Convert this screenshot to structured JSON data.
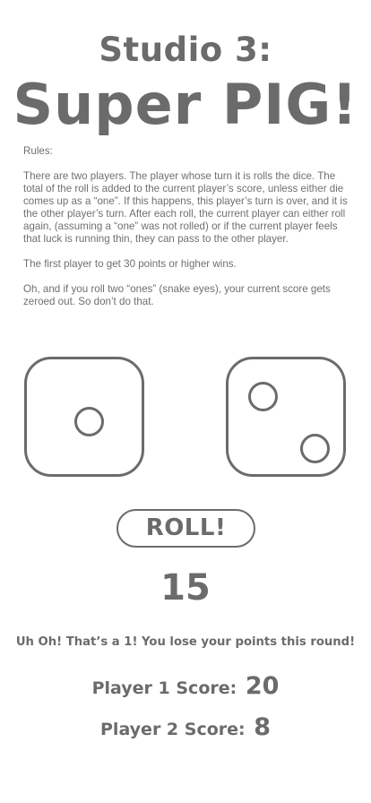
{
  "header": {
    "subtitle": "Studio 3:",
    "title": "Super PIG!"
  },
  "rules": {
    "heading": "Rules:",
    "paragraph_1": "There are two players. The player whose turn it is rolls the dice. The total of the roll is added to the current player’s score, unless either die comes up as a “one”. If this happens, this player’s turn is over, and it is the other player’s turn. After each roll, the current player can either roll again, (assuming a “one” was not rolled) or if the current player feels that luck is running thin, they can pass to the other player.",
    "paragraph_2": "The first player to get 30 points or higher wins.",
    "paragraph_3": "Oh, and if you roll two “ones” (snake eyes), your current score gets zeroed out. So don’t do that."
  },
  "dice": {
    "left_value": 1,
    "right_value": 2
  },
  "roll_button": {
    "label": "ROLL!"
  },
  "roll_total": "15",
  "message": "Uh Oh! That’s a 1! You lose your points this round!",
  "scores": {
    "player1_label": "Player 1 Score:",
    "player1_value": "20",
    "player2_label": "Player 2 Score:",
    "player2_value": "8"
  },
  "colors": {
    "ink": "#6b6b6b",
    "background": "#ffffff"
  }
}
